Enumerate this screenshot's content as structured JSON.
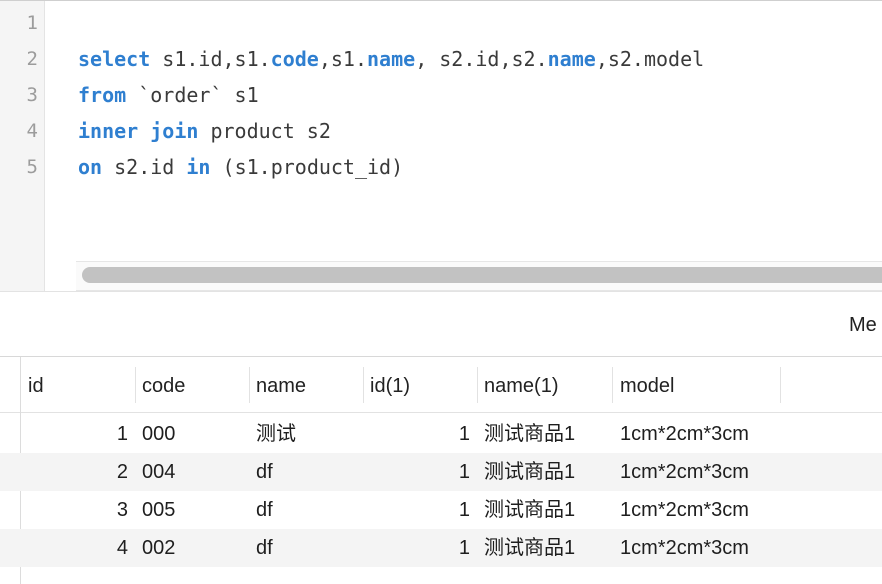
{
  "editor": {
    "line_numbers": [
      "1",
      "2",
      "3",
      "4",
      "5"
    ],
    "lines": [
      [],
      [
        {
          "t": "select",
          "kw": true
        },
        {
          "t": " s1.id,s1.",
          "kw": false
        },
        {
          "t": "code",
          "kw": true
        },
        {
          "t": ",s1.",
          "kw": false
        },
        {
          "t": "name",
          "kw": true
        },
        {
          "t": ", s2.id,s2.",
          "kw": false
        },
        {
          "t": "name",
          "kw": true
        },
        {
          "t": ",s2.model",
          "kw": false
        }
      ],
      [
        {
          "t": "from",
          "kw": true
        },
        {
          "t": " `order` s1",
          "kw": false
        }
      ],
      [
        {
          "t": "inner",
          "kw": true
        },
        {
          "t": " ",
          "kw": false
        },
        {
          "t": "join",
          "kw": true
        },
        {
          "t": " product s2",
          "kw": false
        }
      ],
      [
        {
          "t": "on",
          "kw": true
        },
        {
          "t": " s2.id ",
          "kw": false
        },
        {
          "t": "in",
          "kw": true
        },
        {
          "t": " (s1.product_id)",
          "kw": false
        }
      ]
    ],
    "keyword_color": "#2f7fd0"
  },
  "messages": {
    "tab_label": "Me"
  },
  "results": {
    "columns": [
      "id",
      "code",
      "name",
      "id(1)",
      "name(1)",
      "model"
    ],
    "rows": [
      {
        "id": "1",
        "code": "000",
        "name": "测试",
        "id1": "1",
        "name1": "测试商品1",
        "model": "1cm*2cm*3cm"
      },
      {
        "id": "2",
        "code": "004",
        "name": "df",
        "id1": "1",
        "name1": "测试商品1",
        "model": "1cm*2cm*3cm"
      },
      {
        "id": "3",
        "code": "005",
        "name": "df",
        "id1": "1",
        "name1": "测试商品1",
        "model": "1cm*2cm*3cm"
      },
      {
        "id": "4",
        "code": "002",
        "name": "df",
        "id1": "1",
        "name1": "测试商品1",
        "model": "1cm*2cm*3cm"
      }
    ]
  }
}
